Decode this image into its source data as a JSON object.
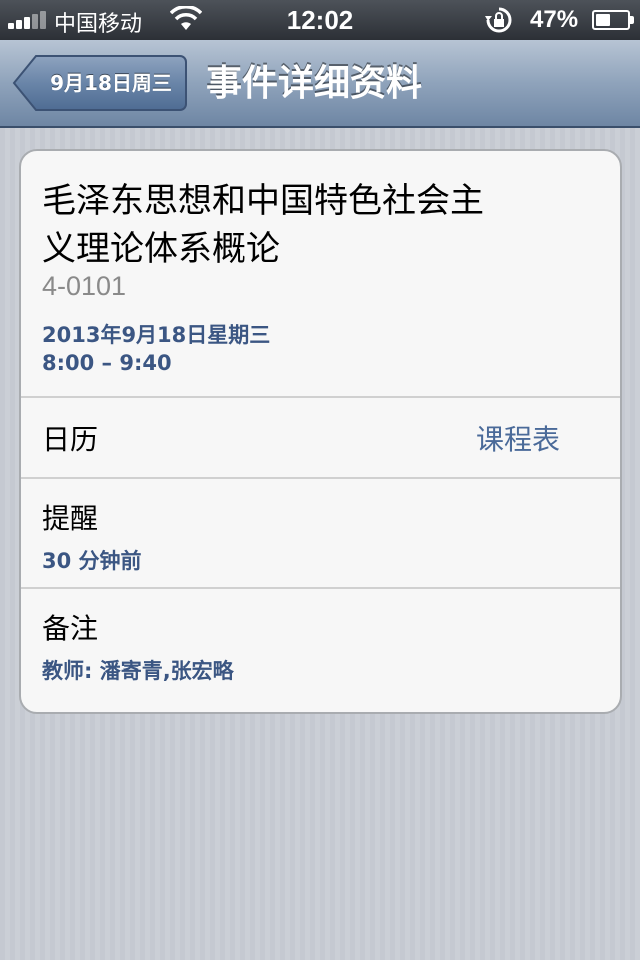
{
  "status_bar": {
    "carrier": "中国移动",
    "time": "12:02",
    "battery_percent": "47%",
    "battery_level": 0.47,
    "icons": [
      "signal-icon",
      "wifi-icon",
      "rotation-lock-icon",
      "battery-icon"
    ]
  },
  "nav": {
    "back_label": "9月18日周三",
    "title": "事件详细资料"
  },
  "event": {
    "title_line1": "毛泽东思想和中国特色社会主",
    "title_line2": "义理论体系概论",
    "location": "4-0101",
    "date": "2013年9月18日星期三",
    "time_range": "8:00 – 9:40"
  },
  "calendar": {
    "label": "日历",
    "value": "课程表"
  },
  "alert": {
    "label": "提醒",
    "value": "30 分钟前"
  },
  "notes": {
    "label": "备注",
    "value": "教师: 潘寄青,张宏略"
  },
  "colors": {
    "accent_text": "#3b5683",
    "nav_bar": "#8fa3bb",
    "background": "#c8ccd3"
  }
}
